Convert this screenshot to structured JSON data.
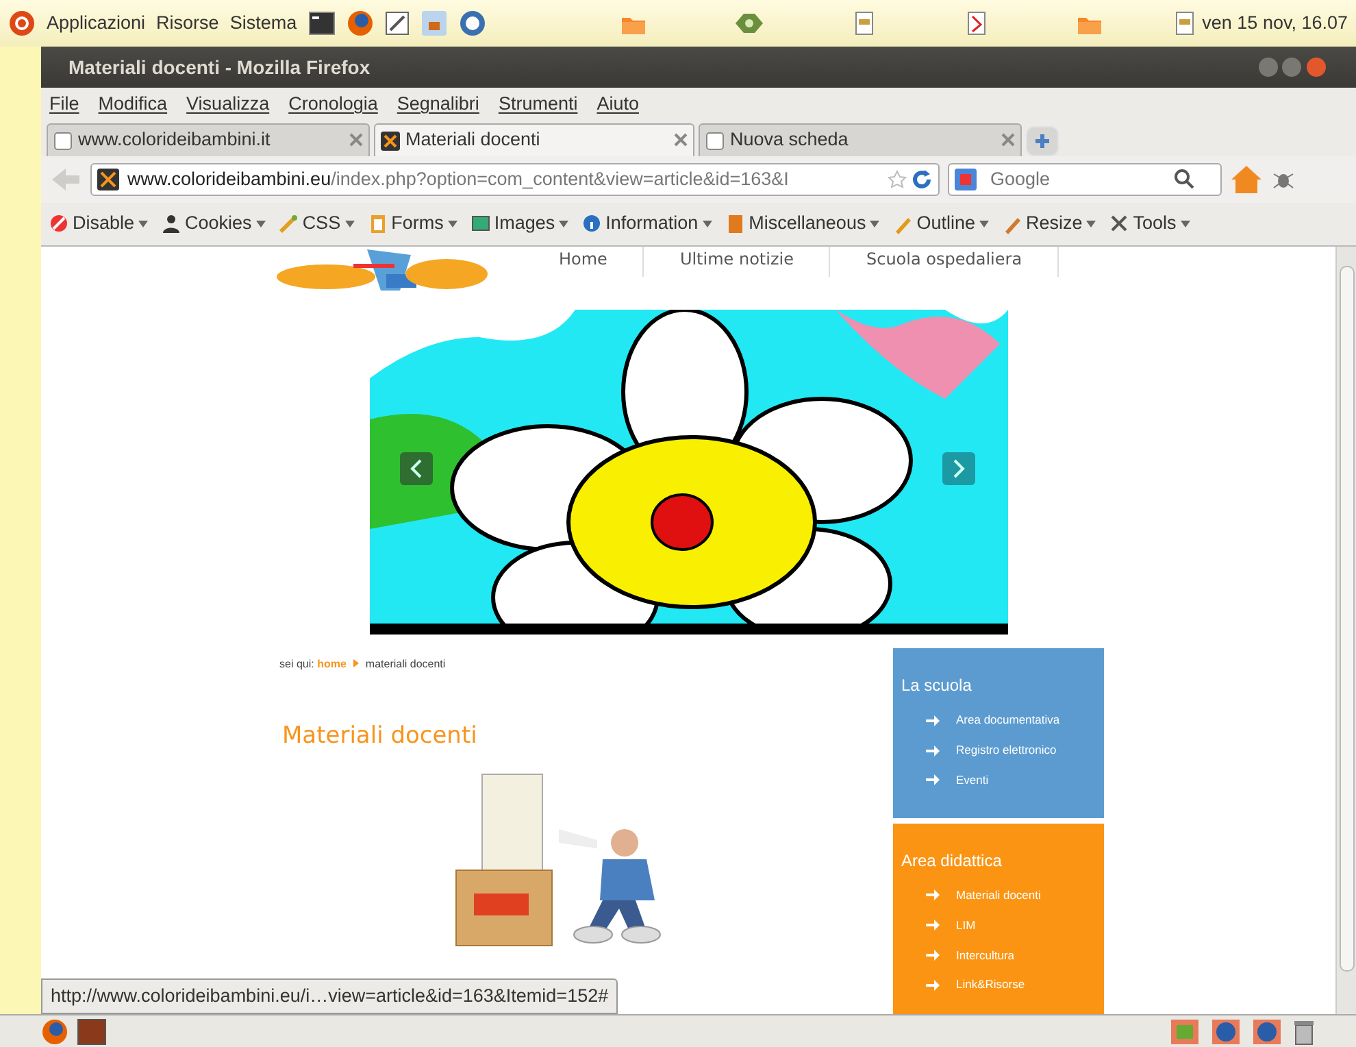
{
  "panel": {
    "menus": [
      "Applicazioni",
      "Risorse",
      "Sistema"
    ],
    "clock": "ven 15 nov, 16.07"
  },
  "window": {
    "title": "Materiali docenti - Mozilla Firefox"
  },
  "menu": [
    "File",
    "Modifica",
    "Visualizza",
    "Cronologia",
    "Segnalibri",
    "Strumenti",
    "Aiuto"
  ],
  "tabs": [
    {
      "label": "www.colorideibambini.it",
      "selected": false
    },
    {
      "label": "Materiali docenti",
      "selected": true
    },
    {
      "label": "Nuova scheda",
      "selected": false
    }
  ],
  "address": {
    "host": "www.colorideibambini.eu",
    "path": "/index.php?option=com_content&view=article&id=163&I"
  },
  "search": {
    "placeholder": "Google"
  },
  "dev_toolbar": [
    "Disable",
    "Cookies",
    "CSS",
    "Forms",
    "Images",
    "Information",
    "Miscellaneous",
    "Outline",
    "Resize",
    "Tools"
  ],
  "site_nav": [
    "Home",
    "Ultime notizie",
    "Scuola ospedaliera"
  ],
  "breadcrumb": {
    "label": "sei qui:",
    "link": "home",
    "current": "materiali docenti"
  },
  "heading": "Materiali docenti",
  "sidebar": [
    {
      "title": "La scuola",
      "color": "#5b9bd0",
      "items": [
        "Area documentativa",
        "Registro elettronico",
        "Eventi"
      ]
    },
    {
      "title": "Area didattica",
      "color": "#fb9413",
      "items": [
        "Materiali docenti",
        "LIM",
        "Intercultura",
        "Link&Risorse"
      ]
    }
  ],
  "status_url": "http://www.colorideibambini.eu/i…view=article&id=163&Itemid=152#"
}
